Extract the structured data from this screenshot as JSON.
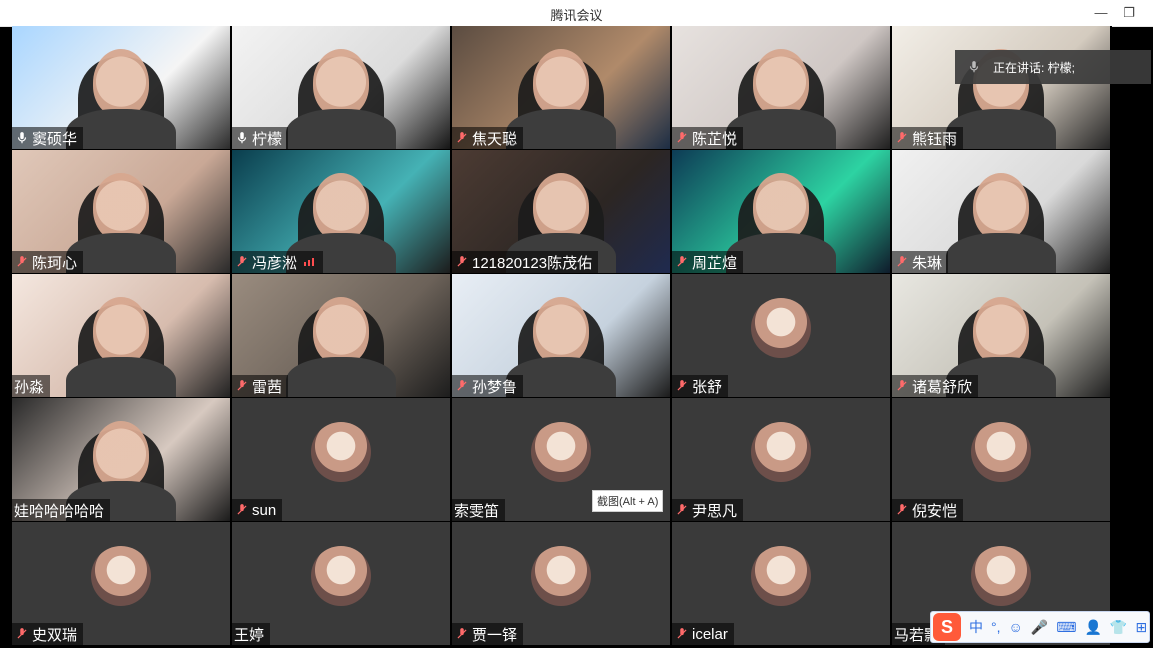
{
  "app": {
    "title": "腾讯会议"
  },
  "window": {
    "minimize_icon": "minimize-icon",
    "restore_icon": "restore-icon"
  },
  "speaker_banner": {
    "text": "正在讲话: 柠檬;"
  },
  "tooltip": {
    "text": "截图(Alt + A)"
  },
  "participants": [
    {
      "name": "窦硕华",
      "mic": "on",
      "avatar": false,
      "colors": [
        "#a9d6ff",
        "#f5f5f5",
        "#2b2b2b"
      ]
    },
    {
      "name": "柠檬",
      "mic": "on",
      "active": true,
      "avatar": false,
      "colors": [
        "#f3f3f3",
        "#dcdcdc",
        "#151515"
      ]
    },
    {
      "name": "焦天聪",
      "mic": "muted",
      "avatar": false,
      "colors": [
        "#5b4c41",
        "#b08a6a",
        "#1c2d44"
      ]
    },
    {
      "name": "陈芷悦",
      "mic": "muted",
      "avatar": false,
      "colors": [
        "#e7e2df",
        "#cfc7c4",
        "#1f1f1f"
      ]
    },
    {
      "name": "熊钰雨",
      "mic": "muted",
      "avatar": false,
      "colors": [
        "#f2eee7",
        "#d4cbbf",
        "#252525"
      ]
    },
    {
      "name": "陈珂心",
      "mic": "muted",
      "avatar": false,
      "colors": [
        "#e0c8b9",
        "#c9a896",
        "#2a2a2a"
      ]
    },
    {
      "name": "冯彦淞",
      "mic": "muted",
      "avatar": false,
      "signal": true,
      "colors": [
        "#0a3d4d",
        "#45b2b5",
        "#1c1c1c"
      ]
    },
    {
      "name": "121820123陈茂佑",
      "mic": "muted",
      "avatar": false,
      "colors": [
        "#4c3b33",
        "#2c2623",
        "#1f2a4f"
      ]
    },
    {
      "name": "周芷煊",
      "mic": "muted",
      "avatar": false,
      "colors": [
        "#0d3b55",
        "#2dd3a2",
        "#0f1b2b"
      ]
    },
    {
      "name": "朱琳",
      "mic": "muted",
      "avatar": false,
      "colors": [
        "#f1f1f1",
        "#d9d9d9",
        "#202020"
      ]
    },
    {
      "name": "孙淼",
      "mic": "none",
      "avatar": false,
      "colors": [
        "#f4e7df",
        "#d7bcae",
        "#222"
      ]
    },
    {
      "name": "雷茜",
      "mic": "muted",
      "avatar": false,
      "colors": [
        "#9a8c7f",
        "#6c6259",
        "#1d1d1d"
      ]
    },
    {
      "name": "孙梦鲁",
      "mic": "muted",
      "avatar": false,
      "colors": [
        "#e8eef5",
        "#c6d2de",
        "#1b1b1b"
      ]
    },
    {
      "name": "张舒",
      "mic": "muted",
      "avatar": true,
      "colors": [
        "#3a3a3a",
        "#3a3a3a",
        "#3a3a3a"
      ]
    },
    {
      "name": "诸葛舒欣",
      "mic": "muted",
      "avatar": false,
      "colors": [
        "#e8e7e1",
        "#c5c2b8",
        "#1e1e1e"
      ]
    },
    {
      "name": "娃哈哈哈哈哈",
      "mic": "none",
      "avatar": false,
      "colors": [
        "#2a2a2a",
        "#d7c9c0",
        "#1b1b1b"
      ]
    },
    {
      "name": "sun",
      "mic": "muted",
      "avatar": true,
      "colors": [
        "#3a3a3a",
        "#3a3a3a",
        "#3a3a3a"
      ]
    },
    {
      "name": "索雯笛",
      "mic": "none",
      "avatar": true,
      "colors": [
        "#3a3a3a",
        "#3a3a3a",
        "#3a3a3a"
      ]
    },
    {
      "name": "尹思凡",
      "mic": "muted",
      "avatar": true,
      "colors": [
        "#3a3a3a",
        "#3a3a3a",
        "#3a3a3a"
      ]
    },
    {
      "name": "倪安恺",
      "mic": "muted",
      "avatar": true,
      "colors": [
        "#3a3a3a",
        "#3a3a3a",
        "#3a3a3a"
      ]
    },
    {
      "name": "史双瑞",
      "mic": "muted",
      "avatar": true,
      "colors": [
        "#3a3a3a",
        "#3a3a3a",
        "#3a3a3a"
      ]
    },
    {
      "name": "王婷",
      "mic": "none",
      "avatar": true,
      "colors": [
        "#3a3a3a",
        "#3a3a3a",
        "#3a3a3a"
      ]
    },
    {
      "name": "贾一铎",
      "mic": "muted",
      "avatar": true,
      "colors": [
        "#3a3a3a",
        "#3a3a3a",
        "#3a3a3a"
      ]
    },
    {
      "name": "icelar",
      "mic": "muted",
      "avatar": true,
      "colors": [
        "#3a3a3a",
        "#3a3a3a",
        "#3a3a3a"
      ]
    },
    {
      "name": "马若颢",
      "mic": "none",
      "avatar": true,
      "colors": [
        "#3a3a3a",
        "#3a3a3a",
        "#3a3a3a"
      ]
    }
  ],
  "ime": {
    "logo": "S",
    "items": [
      "中",
      "°,",
      "☺",
      "🎤",
      "⌨",
      "👤",
      "👕",
      "⊞"
    ]
  }
}
